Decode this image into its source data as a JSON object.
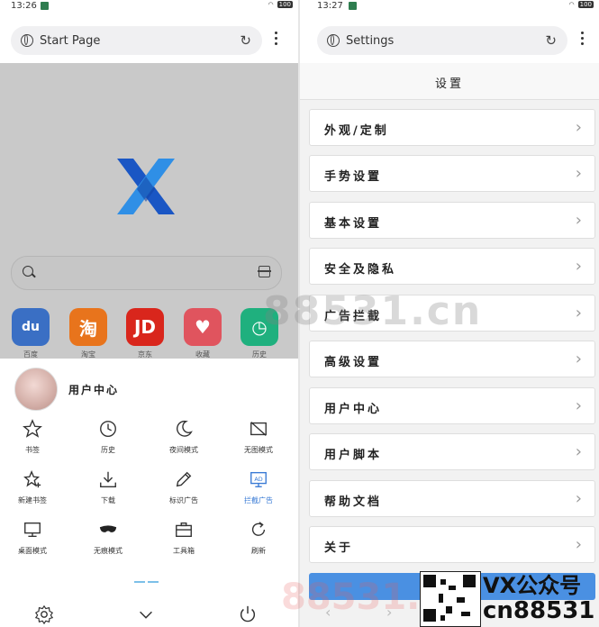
{
  "left": {
    "status": {
      "time": "13:26",
      "battery": "100"
    },
    "url_bar": {
      "text": "Start Page"
    },
    "shortcuts": [
      {
        "label": "百度",
        "glyph": "du",
        "color": "#3a6fc4"
      },
      {
        "label": "淘宝",
        "glyph": "淘",
        "color": "#e8741c"
      },
      {
        "label": "京东",
        "glyph": "JD",
        "color": "#d9261c"
      },
      {
        "label": "收藏",
        "glyph": "♥",
        "color": "#e0545e"
      },
      {
        "label": "历史",
        "glyph": "◷",
        "color": "#1fb07e"
      }
    ],
    "profile": {
      "name": "用户中心"
    },
    "menu": [
      {
        "label": "书签",
        "icon": "star-icon"
      },
      {
        "label": "历史",
        "icon": "clock-icon"
      },
      {
        "label": "夜间模式",
        "icon": "moon-icon"
      },
      {
        "label": "无图模式",
        "icon": "no-image-icon"
      },
      {
        "label": "新建书签",
        "icon": "star-plus-icon"
      },
      {
        "label": "下载",
        "icon": "download-icon"
      },
      {
        "label": "标识广告",
        "icon": "pencil-icon"
      },
      {
        "label": "拦截广告",
        "icon": "ad-block-icon",
        "active": true
      },
      {
        "label": "桌面模式",
        "icon": "desktop-icon"
      },
      {
        "label": "无痕模式",
        "icon": "mask-icon"
      },
      {
        "label": "工具箱",
        "icon": "toolbox-icon"
      },
      {
        "label": "刷新",
        "icon": "refresh-icon"
      }
    ]
  },
  "right": {
    "status": {
      "time": "13:27",
      "battery": "100"
    },
    "url_bar": {
      "text": "Settings"
    },
    "title": "设置",
    "items": [
      "外观/定制",
      "手势设置",
      "基本设置",
      "安全及隐私",
      "广告拦截",
      "高级设置",
      "用户中心",
      "用户脚本",
      "帮助文档",
      "关于"
    ]
  },
  "watermark": {
    "site": "88531.cn",
    "site2": "88531.cn",
    "vx": "VX公众号",
    "code": "cn88531"
  },
  "colors": {
    "accent": "#3a7bd5",
    "button": "#4a90e2",
    "dim": "#c9c9c9"
  }
}
